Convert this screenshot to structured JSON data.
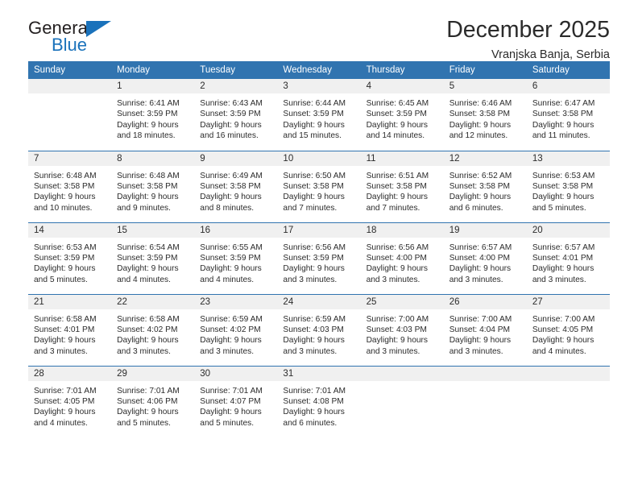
{
  "logo": {
    "text_top": "General",
    "text_bottom": "Blue",
    "triangle_color": "#1a72bb",
    "top_color": "#231f20"
  },
  "header": {
    "title": "December 2025",
    "subtitle": "Vranjska Banja, Serbia"
  },
  "theme": {
    "header_bg": "#3174b0",
    "daynum_bg": "#f0f0f0",
    "row_divider": "#3174b0",
    "text": "#2b2b2b"
  },
  "weekday_headers": [
    "Sunday",
    "Monday",
    "Tuesday",
    "Wednesday",
    "Thursday",
    "Friday",
    "Saturday"
  ],
  "weeks": [
    [
      {
        "day": "",
        "blank": true
      },
      {
        "day": "1",
        "sunrise": "Sunrise: 6:41 AM",
        "sunset": "Sunset: 3:59 PM",
        "daylight_1": "Daylight: 9 hours",
        "daylight_2": "and 18 minutes."
      },
      {
        "day": "2",
        "sunrise": "Sunrise: 6:43 AM",
        "sunset": "Sunset: 3:59 PM",
        "daylight_1": "Daylight: 9 hours",
        "daylight_2": "and 16 minutes."
      },
      {
        "day": "3",
        "sunrise": "Sunrise: 6:44 AM",
        "sunset": "Sunset: 3:59 PM",
        "daylight_1": "Daylight: 9 hours",
        "daylight_2": "and 15 minutes."
      },
      {
        "day": "4",
        "sunrise": "Sunrise: 6:45 AM",
        "sunset": "Sunset: 3:59 PM",
        "daylight_1": "Daylight: 9 hours",
        "daylight_2": "and 14 minutes."
      },
      {
        "day": "5",
        "sunrise": "Sunrise: 6:46 AM",
        "sunset": "Sunset: 3:58 PM",
        "daylight_1": "Daylight: 9 hours",
        "daylight_2": "and 12 minutes."
      },
      {
        "day": "6",
        "sunrise": "Sunrise: 6:47 AM",
        "sunset": "Sunset: 3:58 PM",
        "daylight_1": "Daylight: 9 hours",
        "daylight_2": "and 11 minutes."
      }
    ],
    [
      {
        "day": "7",
        "sunrise": "Sunrise: 6:48 AM",
        "sunset": "Sunset: 3:58 PM",
        "daylight_1": "Daylight: 9 hours",
        "daylight_2": "and 10 minutes."
      },
      {
        "day": "8",
        "sunrise": "Sunrise: 6:48 AM",
        "sunset": "Sunset: 3:58 PM",
        "daylight_1": "Daylight: 9 hours",
        "daylight_2": "and 9 minutes."
      },
      {
        "day": "9",
        "sunrise": "Sunrise: 6:49 AM",
        "sunset": "Sunset: 3:58 PM",
        "daylight_1": "Daylight: 9 hours",
        "daylight_2": "and 8 minutes."
      },
      {
        "day": "10",
        "sunrise": "Sunrise: 6:50 AM",
        "sunset": "Sunset: 3:58 PM",
        "daylight_1": "Daylight: 9 hours",
        "daylight_2": "and 7 minutes."
      },
      {
        "day": "11",
        "sunrise": "Sunrise: 6:51 AM",
        "sunset": "Sunset: 3:58 PM",
        "daylight_1": "Daylight: 9 hours",
        "daylight_2": "and 7 minutes."
      },
      {
        "day": "12",
        "sunrise": "Sunrise: 6:52 AM",
        "sunset": "Sunset: 3:58 PM",
        "daylight_1": "Daylight: 9 hours",
        "daylight_2": "and 6 minutes."
      },
      {
        "day": "13",
        "sunrise": "Sunrise: 6:53 AM",
        "sunset": "Sunset: 3:58 PM",
        "daylight_1": "Daylight: 9 hours",
        "daylight_2": "and 5 minutes."
      }
    ],
    [
      {
        "day": "14",
        "sunrise": "Sunrise: 6:53 AM",
        "sunset": "Sunset: 3:59 PM",
        "daylight_1": "Daylight: 9 hours",
        "daylight_2": "and 5 minutes."
      },
      {
        "day": "15",
        "sunrise": "Sunrise: 6:54 AM",
        "sunset": "Sunset: 3:59 PM",
        "daylight_1": "Daylight: 9 hours",
        "daylight_2": "and 4 minutes."
      },
      {
        "day": "16",
        "sunrise": "Sunrise: 6:55 AM",
        "sunset": "Sunset: 3:59 PM",
        "daylight_1": "Daylight: 9 hours",
        "daylight_2": "and 4 minutes."
      },
      {
        "day": "17",
        "sunrise": "Sunrise: 6:56 AM",
        "sunset": "Sunset: 3:59 PM",
        "daylight_1": "Daylight: 9 hours",
        "daylight_2": "and 3 minutes."
      },
      {
        "day": "18",
        "sunrise": "Sunrise: 6:56 AM",
        "sunset": "Sunset: 4:00 PM",
        "daylight_1": "Daylight: 9 hours",
        "daylight_2": "and 3 minutes."
      },
      {
        "day": "19",
        "sunrise": "Sunrise: 6:57 AM",
        "sunset": "Sunset: 4:00 PM",
        "daylight_1": "Daylight: 9 hours",
        "daylight_2": "and 3 minutes."
      },
      {
        "day": "20",
        "sunrise": "Sunrise: 6:57 AM",
        "sunset": "Sunset: 4:01 PM",
        "daylight_1": "Daylight: 9 hours",
        "daylight_2": "and 3 minutes."
      }
    ],
    [
      {
        "day": "21",
        "sunrise": "Sunrise: 6:58 AM",
        "sunset": "Sunset: 4:01 PM",
        "daylight_1": "Daylight: 9 hours",
        "daylight_2": "and 3 minutes."
      },
      {
        "day": "22",
        "sunrise": "Sunrise: 6:58 AM",
        "sunset": "Sunset: 4:02 PM",
        "daylight_1": "Daylight: 9 hours",
        "daylight_2": "and 3 minutes."
      },
      {
        "day": "23",
        "sunrise": "Sunrise: 6:59 AM",
        "sunset": "Sunset: 4:02 PM",
        "daylight_1": "Daylight: 9 hours",
        "daylight_2": "and 3 minutes."
      },
      {
        "day": "24",
        "sunrise": "Sunrise: 6:59 AM",
        "sunset": "Sunset: 4:03 PM",
        "daylight_1": "Daylight: 9 hours",
        "daylight_2": "and 3 minutes."
      },
      {
        "day": "25",
        "sunrise": "Sunrise: 7:00 AM",
        "sunset": "Sunset: 4:03 PM",
        "daylight_1": "Daylight: 9 hours",
        "daylight_2": "and 3 minutes."
      },
      {
        "day": "26",
        "sunrise": "Sunrise: 7:00 AM",
        "sunset": "Sunset: 4:04 PM",
        "daylight_1": "Daylight: 9 hours",
        "daylight_2": "and 3 minutes."
      },
      {
        "day": "27",
        "sunrise": "Sunrise: 7:00 AM",
        "sunset": "Sunset: 4:05 PM",
        "daylight_1": "Daylight: 9 hours",
        "daylight_2": "and 4 minutes."
      }
    ],
    [
      {
        "day": "28",
        "sunrise": "Sunrise: 7:01 AM",
        "sunset": "Sunset: 4:05 PM",
        "daylight_1": "Daylight: 9 hours",
        "daylight_2": "and 4 minutes."
      },
      {
        "day": "29",
        "sunrise": "Sunrise: 7:01 AM",
        "sunset": "Sunset: 4:06 PM",
        "daylight_1": "Daylight: 9 hours",
        "daylight_2": "and 5 minutes."
      },
      {
        "day": "30",
        "sunrise": "Sunrise: 7:01 AM",
        "sunset": "Sunset: 4:07 PM",
        "daylight_1": "Daylight: 9 hours",
        "daylight_2": "and 5 minutes."
      },
      {
        "day": "31",
        "sunrise": "Sunrise: 7:01 AM",
        "sunset": "Sunset: 4:08 PM",
        "daylight_1": "Daylight: 9 hours",
        "daylight_2": "and 6 minutes."
      },
      {
        "day": "",
        "blank": true
      },
      {
        "day": "",
        "blank": true
      },
      {
        "day": "",
        "blank": true
      }
    ]
  ]
}
